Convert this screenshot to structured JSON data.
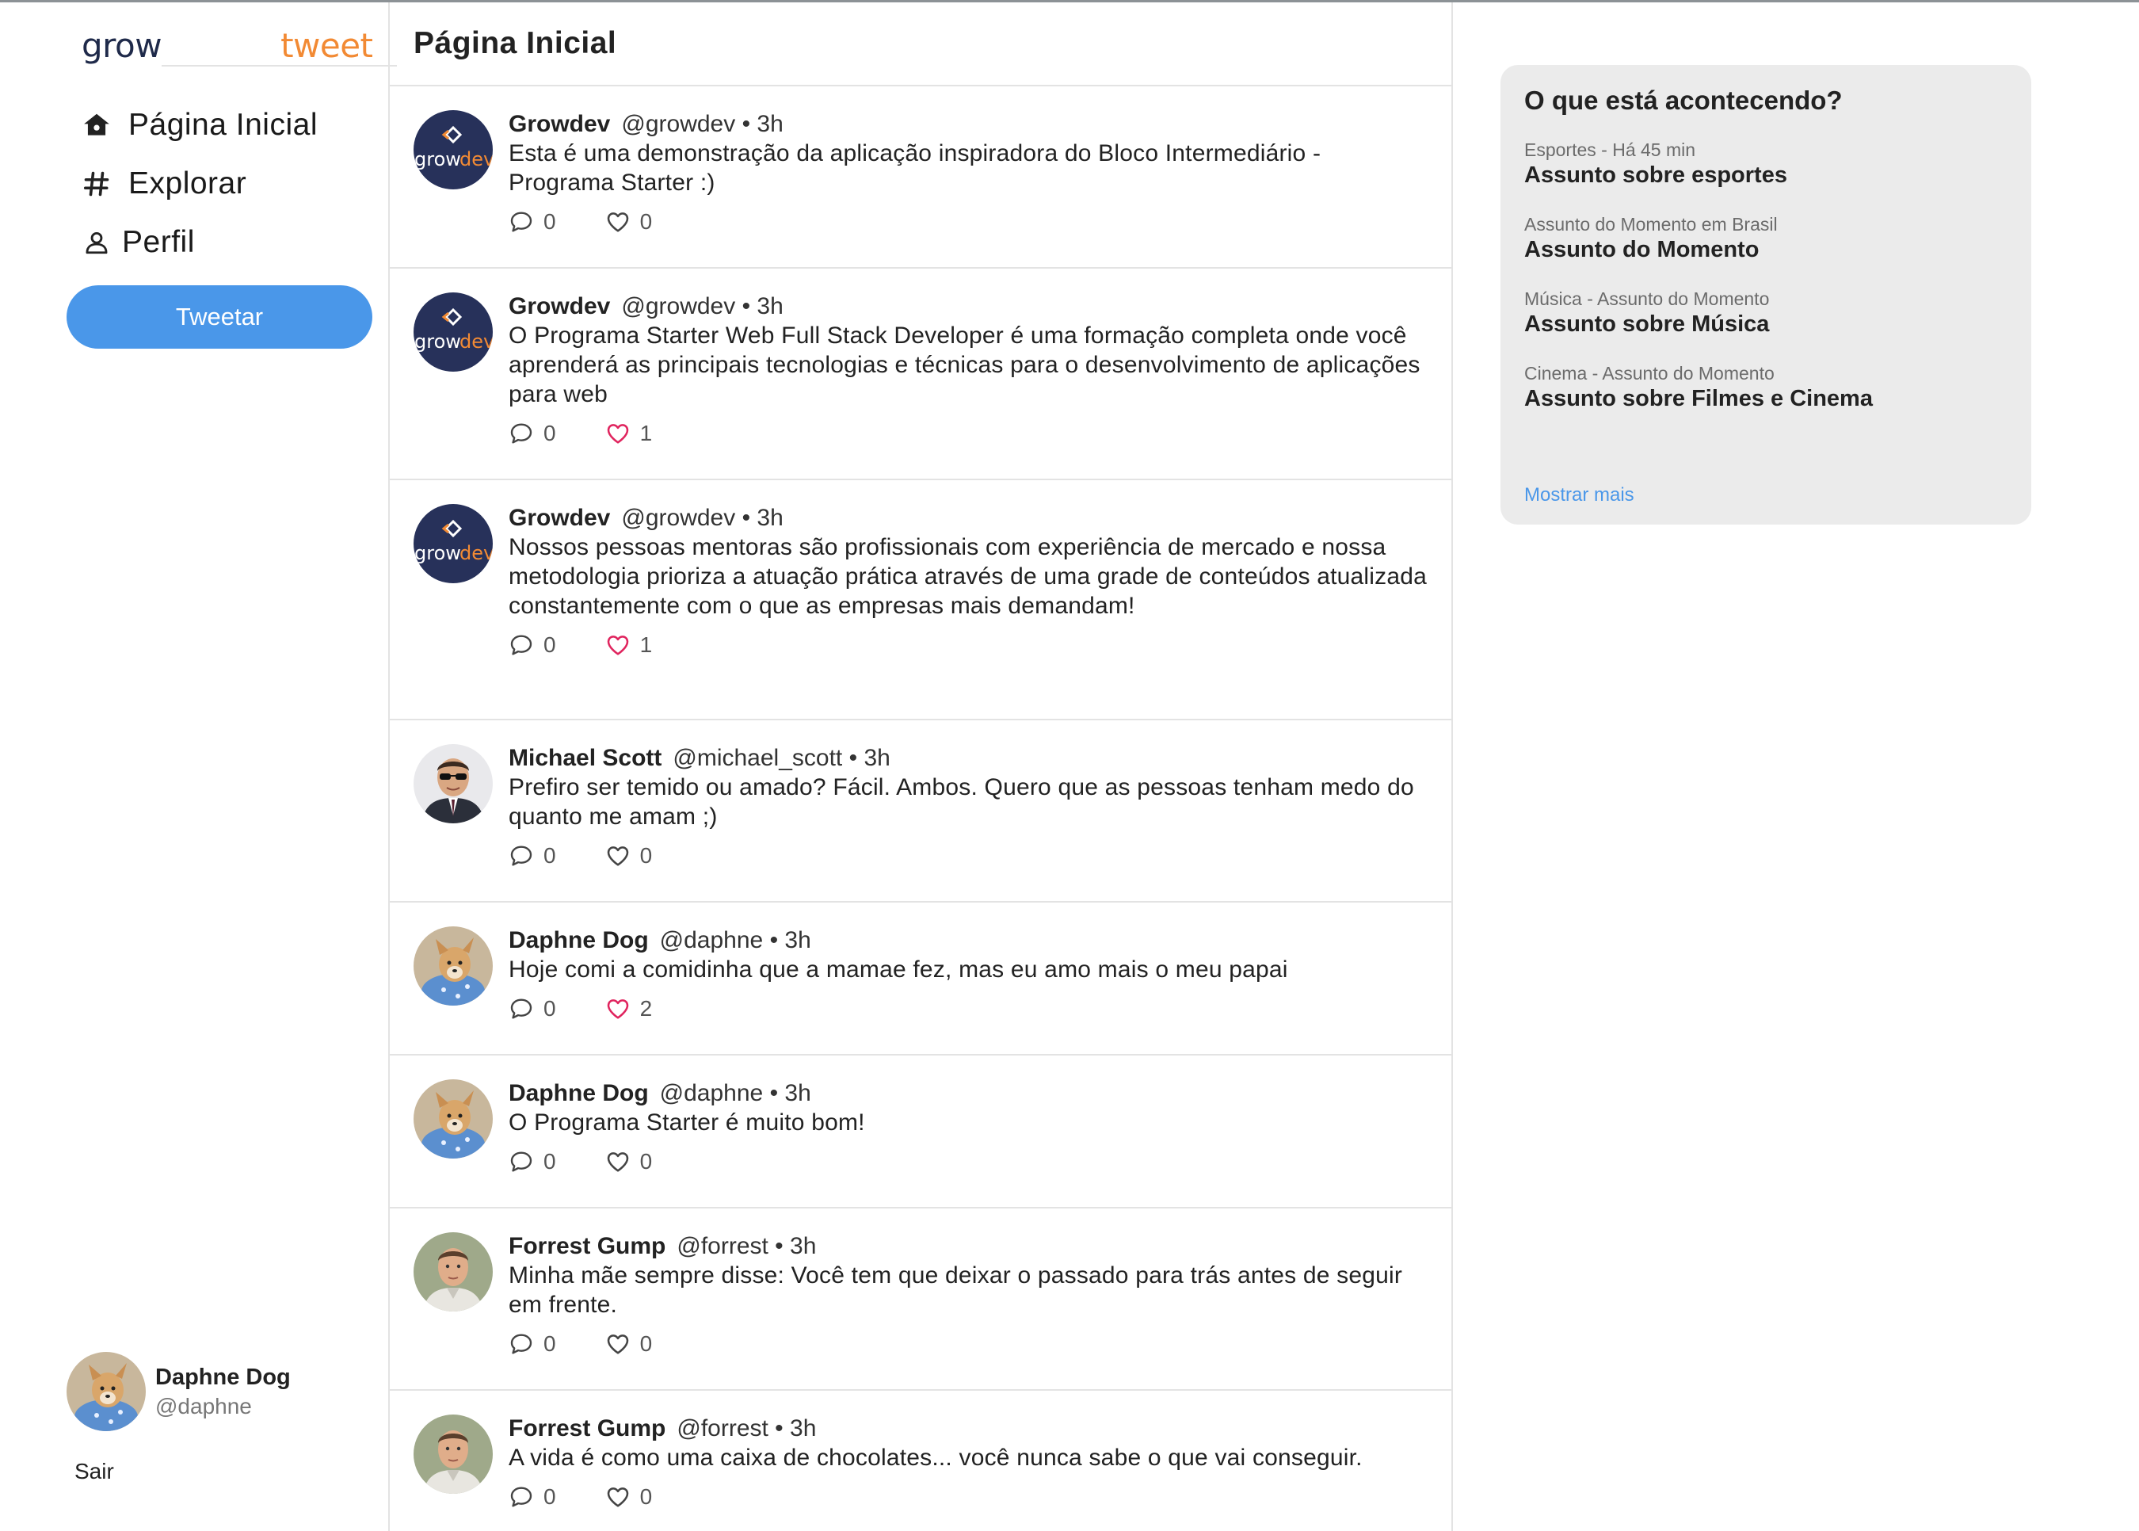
{
  "app": {
    "logo_part1": "grow",
    "logo_part2": "tweet"
  },
  "nav": {
    "items": [
      {
        "label": "Página Inicial",
        "icon": "home-icon"
      },
      {
        "label": "Explorar",
        "icon": "hashtag-icon"
      },
      {
        "label": "Perfil",
        "icon": "user-icon"
      }
    ],
    "tweet_button": "Tweetar"
  },
  "current_user": {
    "name": "Daphne Dog",
    "handle": "@daphne",
    "logout": "Sair"
  },
  "feed": {
    "title": "Página Inicial",
    "tweets": [
      {
        "author": "Growdev",
        "handle": "@growdev",
        "time": "3h",
        "text": "Esta é uma demonstração da aplicação inspiradora do Bloco Intermediário - Programa Starter :)",
        "replies": "0",
        "likes": "0",
        "liked": false,
        "avatar": "growdev"
      },
      {
        "author": "Growdev",
        "handle": "@growdev",
        "time": "3h",
        "text": "O Programa Starter Web Full Stack Developer é uma formação completa onde você aprenderá as principais tecnologias e técnicas para o desenvolvimento de aplicações para web",
        "replies": "0",
        "likes": "1",
        "liked": true,
        "avatar": "growdev"
      },
      {
        "author": "Growdev",
        "handle": "@growdev",
        "time": "3h",
        "text": "Nossos pessoas mentoras são profissionais com experiência de mercado e nossa metodologia prioriza a atuação prática através de uma grade de conteúdos atualizada constantemente com o que as empresas mais demandam!",
        "replies": "0",
        "likes": "1",
        "liked": true,
        "avatar": "growdev"
      },
      {
        "author": "Michael Scott",
        "handle": "@michael_scott",
        "time": "3h",
        "text": "Prefiro ser temido ou amado? Fácil. Ambos. Quero que as pessoas tenham medo do quanto me amam ;)",
        "replies": "0",
        "likes": "0",
        "liked": false,
        "avatar": "michael"
      },
      {
        "author": "Daphne Dog",
        "handle": "@daphne",
        "time": "3h",
        "text": "Hoje comi a comidinha que a mamae fez, mas eu amo mais o meu papai",
        "replies": "0",
        "likes": "2",
        "liked": true,
        "avatar": "daphne"
      },
      {
        "author": "Daphne Dog",
        "handle": "@daphne",
        "time": "3h",
        "text": "O Programa Starter é muito bom!",
        "replies": "0",
        "likes": "0",
        "liked": false,
        "avatar": "daphne"
      },
      {
        "author": "Forrest Gump",
        "handle": "@forrest",
        "time": "3h",
        "text": "Minha mãe sempre disse: Você tem que deixar o passado para trás antes de seguir em frente.",
        "replies": "0",
        "likes": "0",
        "liked": false,
        "avatar": "forrest"
      },
      {
        "author": "Forrest Gump",
        "handle": "@forrest",
        "time": "3h",
        "text": "A vida é como uma caixa de chocolates... você nunca sabe o que vai conseguir.",
        "replies": "0",
        "likes": "0",
        "liked": false,
        "avatar": "forrest"
      }
    ]
  },
  "trends": {
    "title": "O que está acontecendo?",
    "items": [
      {
        "category": "Esportes - Há 45 min",
        "topic": "Assunto sobre esportes"
      },
      {
        "category": "Assunto do Momento em Brasil",
        "topic": "Assunto do Momento"
      },
      {
        "category": "Música - Assunto do Momento",
        "topic": "Assunto sobre Música"
      },
      {
        "category": "Cinema - Assunto do Momento",
        "topic": "Assunto sobre Filmes e Cinema"
      }
    ],
    "show_more": "Mostrar mais"
  },
  "colors": {
    "accent": "#4a97e9",
    "like_active": "#e0245e",
    "logo_dark": "#1f2a4a",
    "logo_orange": "#f28a34"
  }
}
